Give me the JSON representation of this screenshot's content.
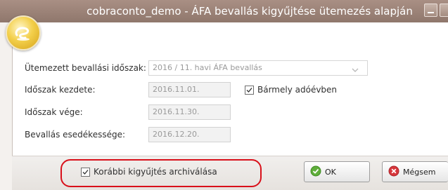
{
  "window": {
    "title": "cobraconto_demo - ÁFA bevallás kigyűjtése ütemezés alapján",
    "app_icon": "coin-logo-icon"
  },
  "form": {
    "scheduled_period_label": "Ütemezett bevallási időszak:",
    "scheduled_period_value": "2016 / 11. havi ÁFA bevallás",
    "period_start_label": "Időszak kezdete:",
    "period_start_value": "2016.11.01.",
    "any_tax_year_label": "Bármely adóévben",
    "any_tax_year_checked": true,
    "period_end_label": "Időszak vége:",
    "period_end_value": "2016.11.30.",
    "due_date_label": "Bevallás esedékessége:",
    "due_date_value": "2016.12.20."
  },
  "footer": {
    "archive_label": "Korábbi kigyűjtés archiválása",
    "archive_checked": true,
    "ok_label": "OK",
    "cancel_label": "Mégsem"
  },
  "colors": {
    "titlebar": "#9c8479",
    "highlight_border": "#d9101a",
    "ok_icon": "#5fae3a",
    "cancel_icon": "#d7373c"
  }
}
